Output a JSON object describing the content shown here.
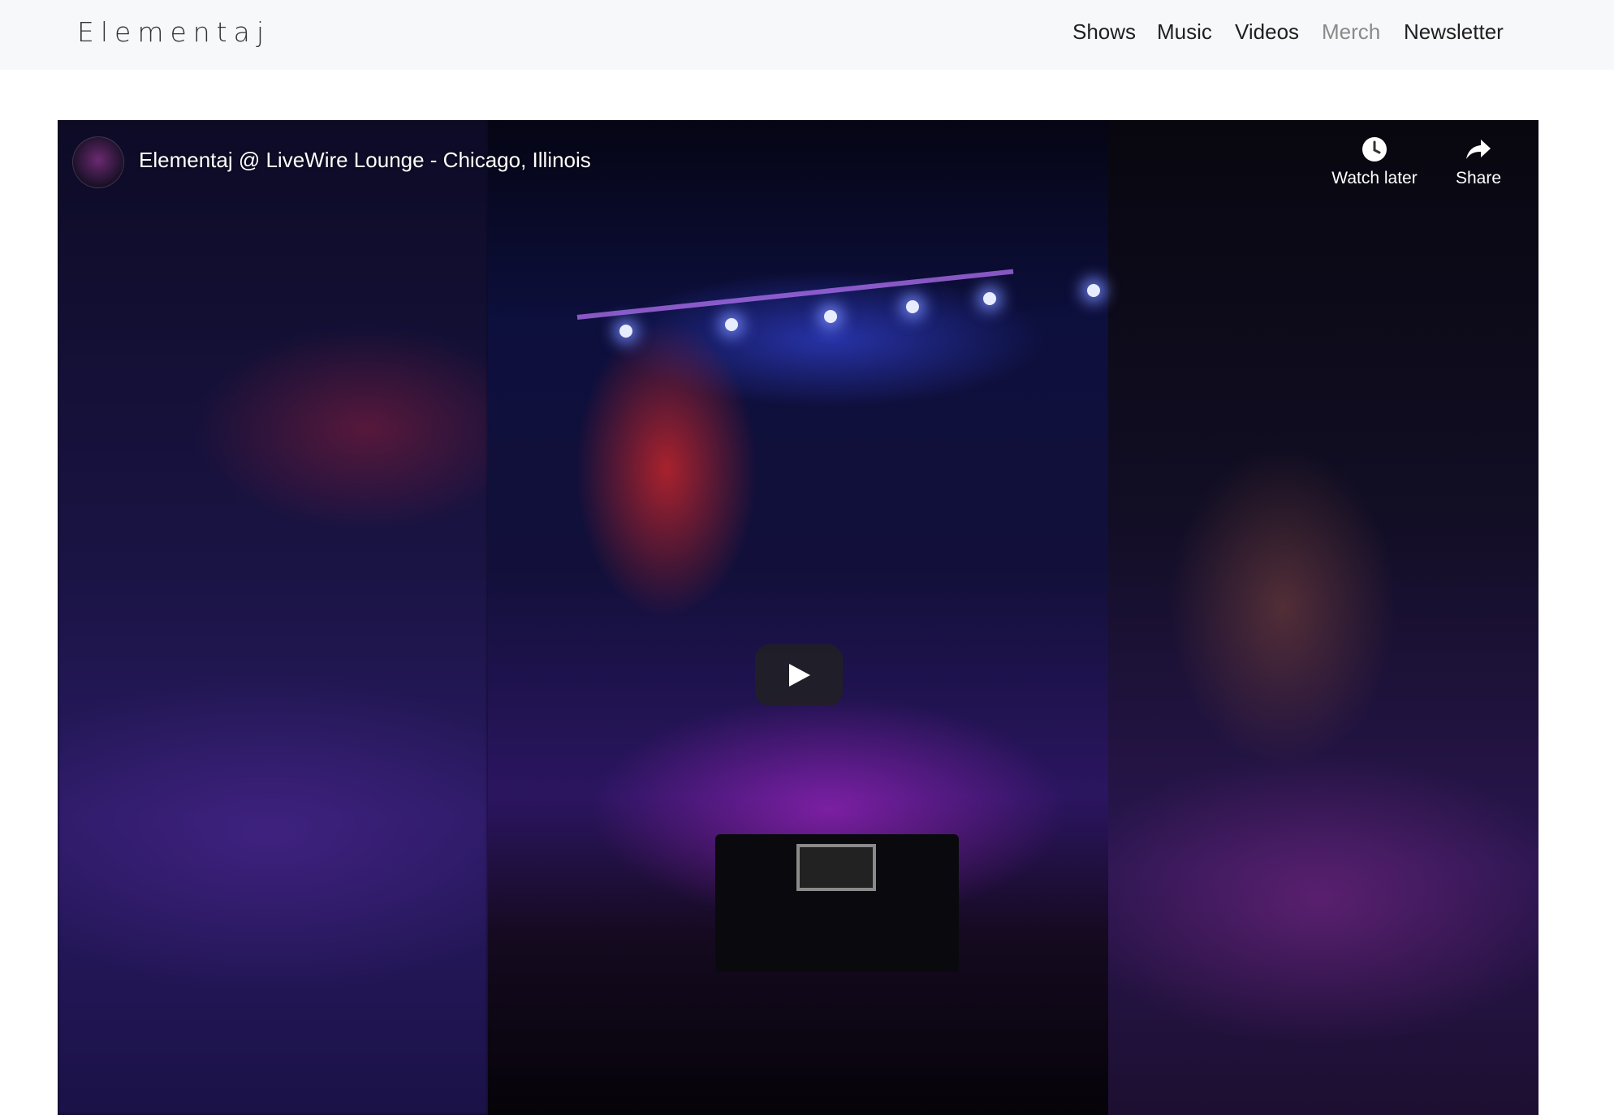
{
  "brand": "Elementaj",
  "nav": {
    "items": [
      {
        "label": "Shows",
        "muted": false
      },
      {
        "label": "Music",
        "muted": false
      },
      {
        "label": "Videos",
        "muted": false
      },
      {
        "label": "Merch",
        "muted": true
      },
      {
        "label": "Newsletter",
        "muted": false
      }
    ]
  },
  "video": {
    "title": "Elementaj @ LiveWire Lounge - Chicago, Illinois",
    "actions": {
      "watch_later": "Watch later",
      "share": "Share"
    },
    "play_icon": "play-icon",
    "colors": {
      "overlay_text": "#ffffff",
      "play_button_bg": "#212121"
    }
  }
}
